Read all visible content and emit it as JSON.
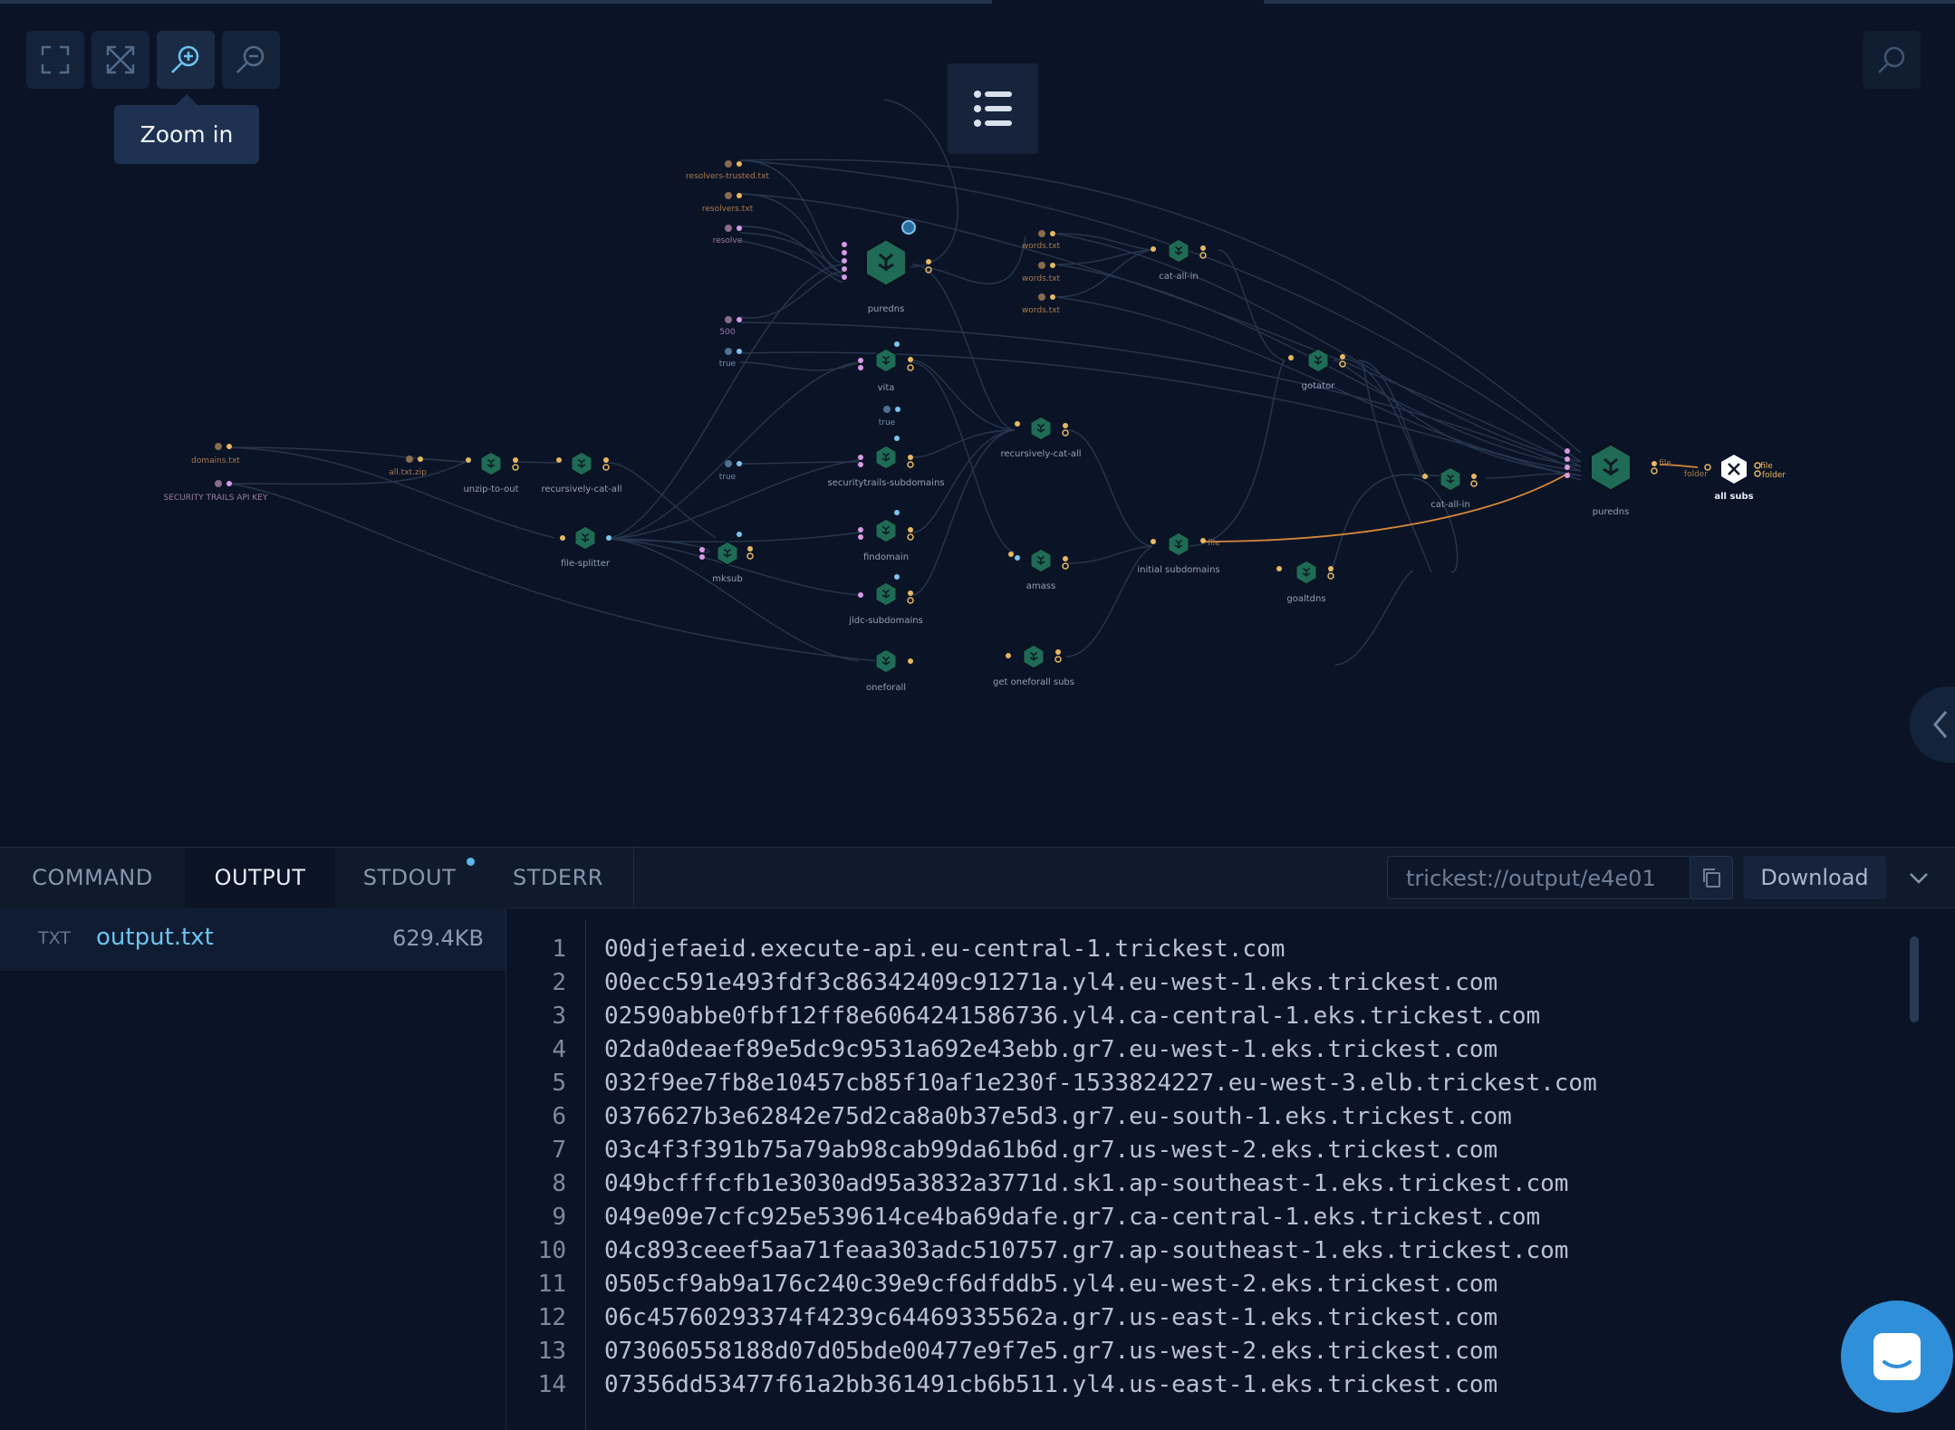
{
  "toolbar": {
    "tooltip": "Zoom in"
  },
  "graph": {
    "nodes": {
      "puredns_top": "puredns",
      "vita": "vita",
      "securitytrails": "securitytrails-subdomains",
      "findomain": "findomain",
      "jldc": "jldc-subdomains",
      "oneforall": "oneforall",
      "mksub": "mksub",
      "file_splitter": "file-splitter",
      "unzip": "unzip-to-out",
      "recursively_cat_left": "recursively-cat-all",
      "recursively_cat_mid": "recursively-cat-all",
      "amass": "amass",
      "get_oneforall": "get oneforall subs",
      "cat_all_in_top": "cat-all-in",
      "cat_all_in_right": "cat-all-in",
      "gotator": "gotator",
      "initial_subdomains": "initial subdomains",
      "goaltdns": "goaltdns",
      "puredns_right": "puredns",
      "all_subs": "all subs"
    },
    "inputs": {
      "resolvers_trusted": "resolvers-trusted.txt",
      "resolvers": "resolvers.txt",
      "resolve": "resolve",
      "n500": "500",
      "true1": "true",
      "true2": "true",
      "true3": "true",
      "domains": "domains.txt",
      "api_key": "SECURITY TRAILS API KEY",
      "all_zip": "all.txt.zip",
      "words1": "words.txt",
      "words2": "words.txt",
      "words3": "words.txt"
    },
    "port_labels": {
      "file": "file",
      "folder": "folder"
    }
  },
  "panel": {
    "tabs": [
      "COMMAND",
      "OUTPUT",
      "STDOUT",
      "STDERR"
    ],
    "active_tab": "OUTPUT",
    "output_path": "trickest://output/e4e01",
    "download_label": "Download",
    "file": {
      "type": "TXT",
      "name": "output.txt",
      "size": "629.4KB"
    },
    "lines": [
      {
        "n": "1",
        "t": "00djefaeid.execute-api.eu-central-1.trickest.com"
      },
      {
        "n": "2",
        "t": "00ecc591e493fdf3c86342409c91271a.yl4.eu-west-1.eks.trickest.com"
      },
      {
        "n": "3",
        "t": "02590abbe0fbf12ff8e6064241586736.yl4.ca-central-1.eks.trickest.com"
      },
      {
        "n": "4",
        "t": "02da0deaef89e5dc9c9531a692e43ebb.gr7.eu-west-1.eks.trickest.com"
      },
      {
        "n": "5",
        "t": "032f9ee7fb8e10457cb85f10af1e230f-1533824227.eu-west-3.elb.trickest.com"
      },
      {
        "n": "6",
        "t": "0376627b3e62842e75d2ca8a0b37e5d3.gr7.eu-south-1.eks.trickest.com"
      },
      {
        "n": "7",
        "t": "03c4f3f391b75a79ab98cab99da61b6d.gr7.us-west-2.eks.trickest.com"
      },
      {
        "n": "8",
        "t": "049bcfffcfb1e3030ad95a3832a3771d.sk1.ap-southeast-1.eks.trickest.com"
      },
      {
        "n": "9",
        "t": "049e09e7cfc925e539614ce4ba69dafe.gr7.ca-central-1.eks.trickest.com"
      },
      {
        "n": "10",
        "t": "04c893ceeef5aa71feaa303adc510757.gr7.ap-southeast-1.eks.trickest.com"
      },
      {
        "n": "11",
        "t": "0505cf9ab9a176c240c39e9cf6dfddb5.yl4.eu-west-2.eks.trickest.com"
      },
      {
        "n": "12",
        "t": "06c45760293374f4239c64469335562a.gr7.us-east-1.eks.trickest.com"
      },
      {
        "n": "13",
        "t": "073060558188d07d05bde00477e9f7e5.gr7.us-west-2.eks.trickest.com"
      },
      {
        "n": "14",
        "t": "07356dd53477f61a2bb361491cb6b511.yl4.us-east-1.eks.trickest.com"
      }
    ]
  },
  "colors": {
    "background": "#0b1426",
    "accent": "#6cc3f0",
    "node_fill": "#1f6b55",
    "edge_highlight": "#d9883a"
  }
}
